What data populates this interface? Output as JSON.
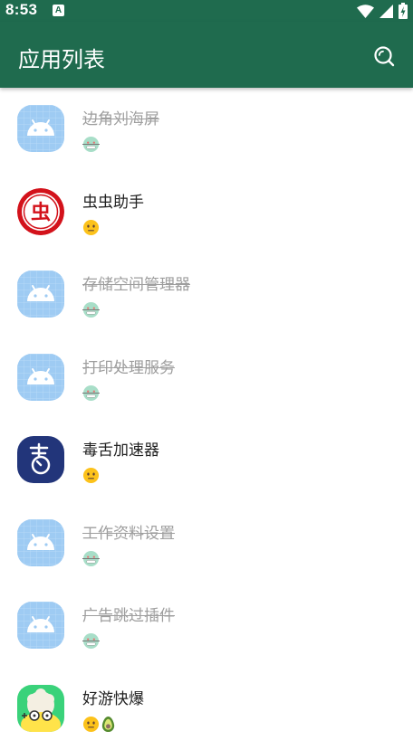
{
  "status_bar": {
    "time": "8:53",
    "notification_icon": "a-notification-icon",
    "wifi_icon": "wifi-icon",
    "signal_icon": "signal-icon",
    "battery_icon": "battery-charging-icon"
  },
  "app_bar": {
    "title": "应用列表",
    "search_icon": "search-icon",
    "background_color": "#1f6b4e"
  },
  "apps": [
    {
      "name": "边角刘海屏",
      "disabled": true,
      "icon": "android-icon",
      "status": "disabled-face"
    },
    {
      "name": "虫虫助手",
      "disabled": false,
      "icon": "chongchong-icon",
      "status": "neutral-face"
    },
    {
      "name": "存储空间管理器",
      "disabled": true,
      "icon": "android-icon",
      "status": "disabled-face"
    },
    {
      "name": "打印处理服务",
      "disabled": true,
      "icon": "android-icon",
      "status": "disabled-face"
    },
    {
      "name": "毒舌加速器",
      "disabled": false,
      "icon": "dushe-icon",
      "status": "neutral-face"
    },
    {
      "name": "工作资料设置",
      "disabled": true,
      "icon": "android-icon",
      "status": "disabled-face"
    },
    {
      "name": "广告跳过插件",
      "disabled": true,
      "icon": "android-icon",
      "status": "disabled-face"
    },
    {
      "name": "好游快爆",
      "disabled": false,
      "icon": "haoyou-icon",
      "status": "neutral-face-avocado"
    }
  ],
  "colors": {
    "accent": "#1f6b4e",
    "disabled_text": "#9e9e9e",
    "text": "#212121"
  }
}
